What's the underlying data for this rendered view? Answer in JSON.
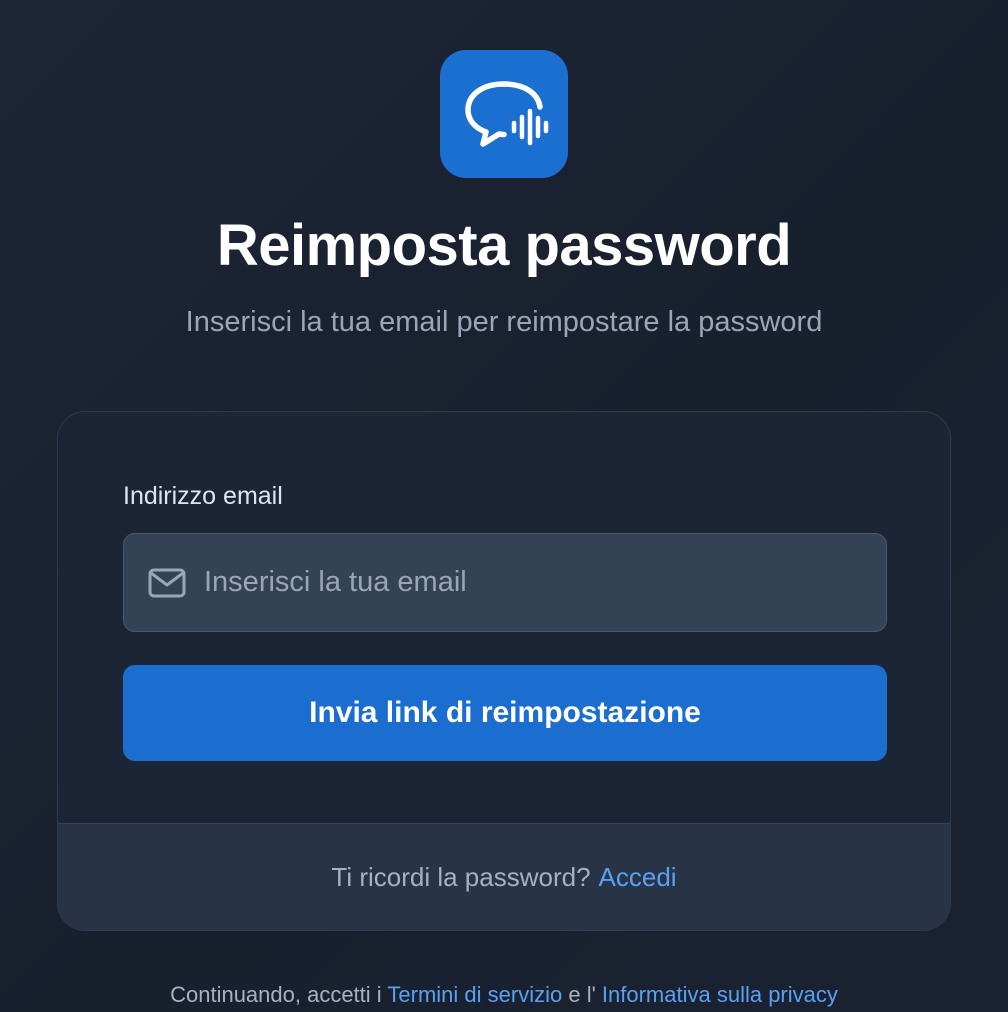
{
  "brand": {
    "icon": "chat-bubble-waveform-icon",
    "accent_color": "#1a6fd0"
  },
  "header": {
    "title": "Reimposta password",
    "subtitle": "Inserisci la tua email per reimpostare la password"
  },
  "form": {
    "email_label": "Indirizzo email",
    "email_placeholder": "Inserisci la tua email",
    "email_value": "",
    "email_icon": "mail-icon",
    "submit_label": "Invia link di reimpostazione"
  },
  "card_footer": {
    "prompt": "Ti ricordi la password?",
    "login_link": "Accedi"
  },
  "legal": {
    "prefix": "Continuando, accetti i",
    "terms_link": "Termini di servizio",
    "conjunction": "e l'",
    "privacy_link": "Informativa sulla privacy"
  }
}
